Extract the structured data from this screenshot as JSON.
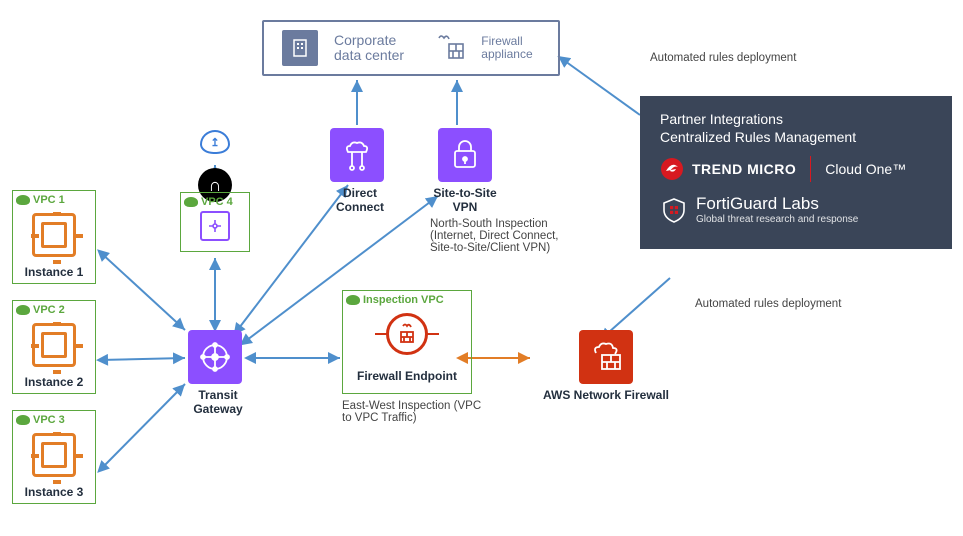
{
  "vpc": {
    "v1": {
      "title": "VPC 1",
      "instance": "Instance 1"
    },
    "v2": {
      "title": "VPC 2",
      "instance": "Instance 2"
    },
    "v3": {
      "title": "VPC 3",
      "instance": "Instance 3"
    },
    "v4": {
      "title": "VPC 4"
    },
    "inspection": {
      "title": "Inspection VPC",
      "endpoint": "Firewall Endpoint"
    }
  },
  "corp": {
    "dc": "Corporate data center",
    "fw": "Firewall appliance"
  },
  "nodes": {
    "direct_connect": "Direct Connect",
    "site_vpn": "Site-to-Site VPN",
    "transit_gateway": "Transit Gateway",
    "aws_nfw": "AWS Network Firewall"
  },
  "partner": {
    "title1": "Partner Integrations",
    "title2": "Centralized Rules Management",
    "trend_micro": "TREND MICRO",
    "cloud_one": "Cloud One™",
    "fortiguard": "FortiGuard Labs",
    "fortiguard_sub": "Global threat research and response"
  },
  "text": {
    "auto_deploy": "Automated rules deployment",
    "north_south": "North-South Inspection (Internet, Direct Connect, Site-to-Site/Client VPN)",
    "east_west": "East-West Inspection (VPC to VPC Traffic)"
  }
}
